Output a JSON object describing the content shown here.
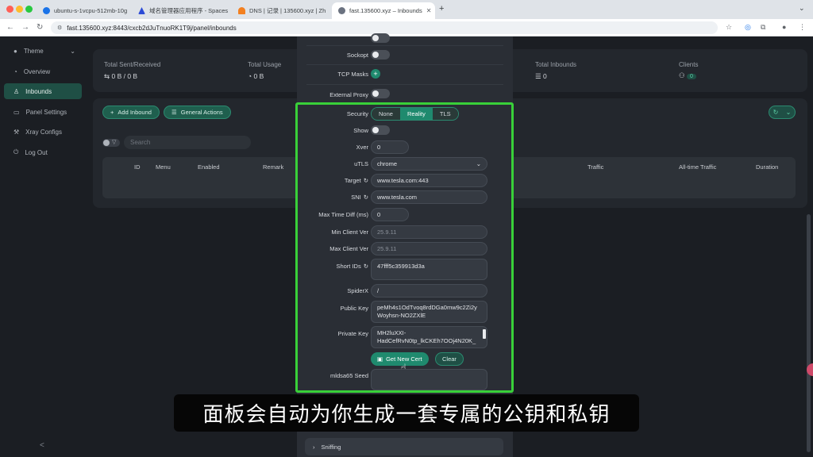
{
  "browser": {
    "tabs": [
      {
        "title": "ubuntu-s-1vcpu-512mb-10g",
        "favicon_color": "#1a73e8",
        "active": false
      },
      {
        "title": "域名管理器应用程序 - Spaces",
        "favicon_color": "#2c4bd6",
        "active": false
      },
      {
        "title": "DNS | 记录 | 135600.xyz | Zh",
        "favicon_color": "#f38020",
        "active": false
      },
      {
        "title": "fast.135600.xyz – Inbounds",
        "favicon_color": "#6b7280",
        "active": true
      }
    ],
    "url": "fast.135600.xyz:8443/cxcb2dJuTnuoRK1T9j/panel/inbounds"
  },
  "sidebar": {
    "items": [
      {
        "label": "Theme",
        "icon": "bulb-icon"
      },
      {
        "label": "Overview",
        "icon": "dashboard-icon"
      },
      {
        "label": "Inbounds",
        "icon": "user-icon"
      },
      {
        "label": "Panel Settings",
        "icon": "settings-icon"
      },
      {
        "label": "Xray Configs",
        "icon": "tool-icon"
      },
      {
        "label": "Log Out",
        "icon": "logout-icon"
      }
    ],
    "collapse": "<"
  },
  "stats": {
    "sent_received_label": "Total Sent/Received",
    "sent_received_value": "0 B / 0 B",
    "usage_label": "Total Usage",
    "usage_value": "0 B",
    "inbounds_label": "Total Inbounds",
    "inbounds_value": "0",
    "clients_label": "Clients",
    "clients_value": "0"
  },
  "toolbar": {
    "add_inbound": "Add Inbound",
    "general_actions": "General Actions",
    "search_placeholder": "Search"
  },
  "table": {
    "headers": [
      "ID",
      "Menu",
      "Enabled",
      "Remark",
      "Traffic",
      "All-time Traffic",
      "Duration"
    ]
  },
  "form": {
    "sockopt_label": "Sockopt",
    "tcp_masks_label": "TCP Masks",
    "tcp_masks_add": "+",
    "external_proxy_label": "External Proxy",
    "security_label": "Security",
    "security_options": [
      "None",
      "Reality",
      "TLS"
    ],
    "security_selected": "Reality",
    "show_label": "Show",
    "xver_label": "Xver",
    "xver_value": "0",
    "utls_label": "uTLS",
    "utls_value": "chrome",
    "target_label": "Target",
    "target_value": "www.tesla.com:443",
    "sni_label": "SNI",
    "sni_value": "www.tesla.com",
    "max_time_diff_label": "Max Time Diff (ms)",
    "max_time_diff_value": "0",
    "min_client_ver_label": "Min Client Ver",
    "min_client_ver_placeholder": "25.9.11",
    "max_client_ver_label": "Max Client Ver",
    "max_client_ver_placeholder": "25.9.11",
    "short_ids_label": "Short IDs",
    "short_ids_value": "47fff5c359913d3a",
    "spiderx_label": "SpiderX",
    "spiderx_value": "/",
    "public_key_label": "Public Key",
    "public_key_value_line1": "peMh4s1OdTvoq8rdDGa0mw9c2Zi2y",
    "public_key_value_line2": "Woyhsn-NO2ZXlE",
    "private_key_label": "Private Key",
    "private_key_value_line1": "MH2luXXI-",
    "private_key_value_line2": "HadCefRvN0tp_lkCKEh7OOj4N20K_",
    "get_new_cert": "Get New Cert",
    "clear": "Clear",
    "mldsa65_label": "mldsa65 Seed",
    "sniffing_label": "Sniffing"
  },
  "subtitle": "面板会自动为你生成一套专属的公钥和私钥",
  "colors": {
    "accent": "#1f8a6e",
    "highlight": "#39d039",
    "background": "#1b1e23"
  }
}
